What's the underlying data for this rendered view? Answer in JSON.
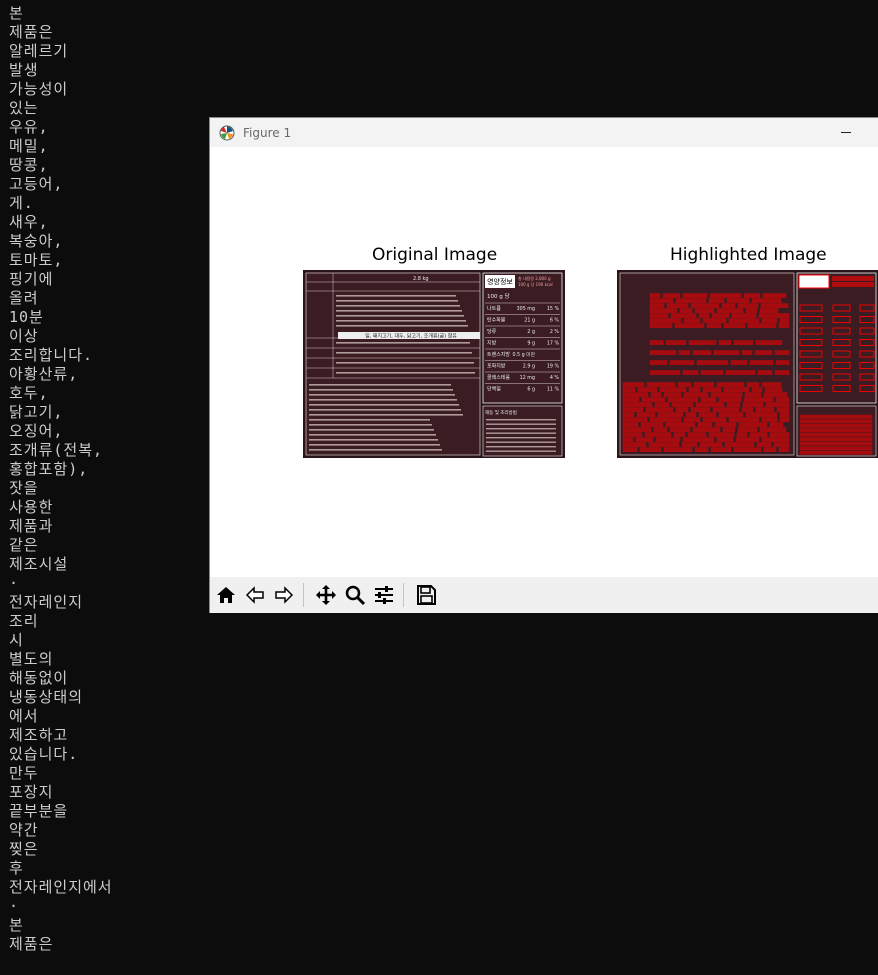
{
  "terminal": {
    "lines": [
      "본",
      "제품은",
      "알레르기",
      "발생",
      "가능성이",
      "있는",
      "우유,",
      "메밀,",
      "땅콩,",
      "고등어,",
      "게.",
      "새우,",
      "복숭아,",
      "토마토,",
      "핑기에",
      "올려",
      "10분",
      "이상",
      "조리합니다.",
      "아황산류,",
      "호두,",
      "닭고기,",
      "오징어,",
      "조개류(전복,",
      "홍합포함),",
      "잣을",
      "사용한",
      "제품과",
      "같은",
      "제조시설",
      "·",
      "전자레인지",
      "조리",
      "시",
      "별도의",
      "해동없이",
      "냉동상태의",
      "에서",
      "제조하고",
      "있습니다.",
      "만두",
      "포장지",
      "끝부분을",
      "약간",
      "찢은",
      "후",
      "전자레인지에서",
      "·",
      "본",
      "제품은"
    ]
  },
  "window": {
    "title": "Figure 1",
    "icon": "matplotlib-icon"
  },
  "figure": {
    "axes": [
      {
        "title": "Original Image"
      },
      {
        "title": "Highlighted Image"
      }
    ],
    "nutrition_label": {
      "heading": "영양정보",
      "serving": "100 g 당",
      "total": "총 내용량 2,800 g",
      "per": "100 g 당 190 kcal",
      "rows": [
        {
          "name": "나트륨",
          "amount": "305 mg",
          "pct": "15 %"
        },
        {
          "name": "탄수화물",
          "amount": "21 g",
          "pct": "6 %"
        },
        {
          "name": "당류",
          "amount": "2 g",
          "pct": "2 %"
        },
        {
          "name": "지방",
          "amount": "9 g",
          "pct": "17 %"
        },
        {
          "name": "트랜스지방",
          "amount": "0.5 g 미만",
          "pct": ""
        },
        {
          "name": "포화지방",
          "amount": "2.9 g",
          "pct": "19 %"
        },
        {
          "name": "콜레스테롤",
          "amount": "12 mg",
          "pct": "4 %"
        },
        {
          "name": "단백질",
          "amount": "6 g",
          "pct": "11 %"
        }
      ],
      "product_weight": "2.8 kg",
      "banner": "밀, 돼지고기, 대두, 닭고기, 조개류(굴) 함유",
      "instructions_heading": "해동 및 조리방법"
    }
  },
  "toolbar": {
    "buttons": [
      "home-icon",
      "back-arrow-icon",
      "forward-arrow-icon",
      "pan-move-icon",
      "zoom-magnifier-icon",
      "configure-subplots-icon",
      "save-floppy-icon"
    ]
  },
  "colors": {
    "highlight": "#ff0000",
    "terminal_bg": "#0c0c0c",
    "terminal_fg": "#cccccc"
  }
}
